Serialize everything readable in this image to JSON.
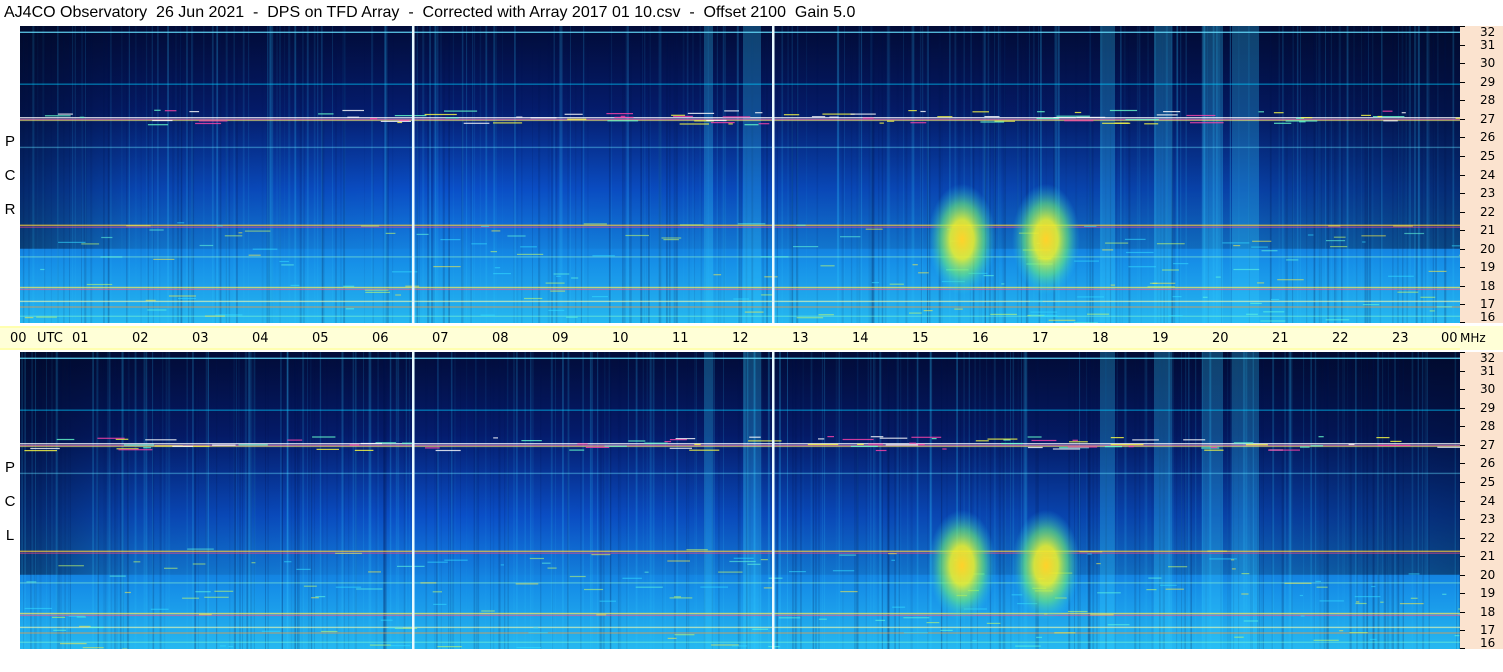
{
  "title": "AJ4CO Observatory  26 Jun 2021  -  DPS on TFD Array  -  Corrected with Array 2017 01 10.csv  -  Offset 2100  Gain 5.0",
  "chart_data": [
    {
      "type": "heatmap",
      "panel": "RCP",
      "polarization_letters": [
        "R",
        "C",
        "P"
      ],
      "x_label": "UTC",
      "x_ticks": [
        "00",
        "01",
        "02",
        "03",
        "04",
        "05",
        "06",
        "07",
        "08",
        "09",
        "10",
        "11",
        "12",
        "13",
        "14",
        "15",
        "16",
        "17",
        "18",
        "19",
        "20",
        "21",
        "22",
        "23",
        "00"
      ],
      "y_label": "MHz",
      "y_ticks": [
        32,
        31,
        30,
        29,
        28,
        27,
        26,
        25,
        24,
        23,
        22,
        21,
        20,
        19,
        18,
        17,
        16
      ],
      "xlim_hours": [
        0,
        24
      ],
      "ylim_mhz": [
        16,
        32
      ],
      "vertical_markers_hours": [
        6.55,
        12.55
      ],
      "bursts": [
        {
          "time_hours": 15.7,
          "freq_low_mhz": 17.5,
          "freq_high_mhz": 23.5
        },
        {
          "time_hours": 17.1,
          "freq_low_mhz": 17.5,
          "freq_high_mhz": 23.5
        }
      ]
    },
    {
      "type": "heatmap",
      "panel": "LCP",
      "polarization_letters": [
        "L",
        "C",
        "P"
      ],
      "x_label": "UTC",
      "x_ticks": [
        "00",
        "01",
        "02",
        "03",
        "04",
        "05",
        "06",
        "07",
        "08",
        "09",
        "10",
        "11",
        "12",
        "13",
        "14",
        "15",
        "16",
        "17",
        "18",
        "19",
        "20",
        "21",
        "22",
        "23",
        "00"
      ],
      "y_label": "MHz",
      "y_ticks": [
        32,
        31,
        30,
        29,
        28,
        27,
        26,
        25,
        24,
        23,
        22,
        21,
        20,
        19,
        18,
        17,
        16
      ],
      "xlim_hours": [
        0,
        24
      ],
      "ylim_mhz": [
        16,
        32
      ],
      "vertical_markers_hours": [
        6.55,
        12.55
      ],
      "bursts": [
        {
          "time_hours": 15.7,
          "freq_low_mhz": 17.5,
          "freq_high_mhz": 23.5
        },
        {
          "time_hours": 17.1,
          "freq_low_mhz": 17.5,
          "freq_high_mhz": 23.5
        }
      ]
    }
  ]
}
